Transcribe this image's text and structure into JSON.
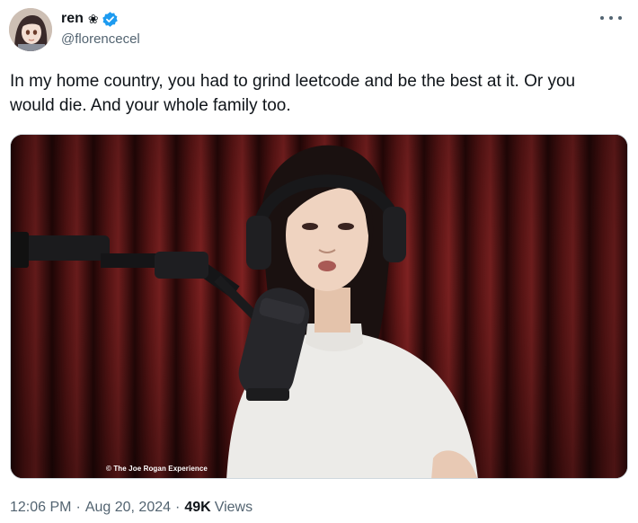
{
  "author": {
    "display_name": "ren",
    "name_emoji": "❀",
    "handle": "@florencecel",
    "verified": true
  },
  "menu": {
    "icon": "more-options-icon"
  },
  "tweet": {
    "text": "In my home country, you had to grind leetcode and be the best at it. Or you would die. And your whole family too."
  },
  "media": {
    "watermark": "© The Joe Rogan Experience"
  },
  "meta": {
    "time": "12:06 PM",
    "separator": "·",
    "date": "Aug 20, 2024",
    "views_count": "49K",
    "views_label": "Views"
  },
  "colors": {
    "text": "#0f1419",
    "secondary": "#536471",
    "verified_blue": "#1d9bf0",
    "curtain": "#5a1414"
  }
}
